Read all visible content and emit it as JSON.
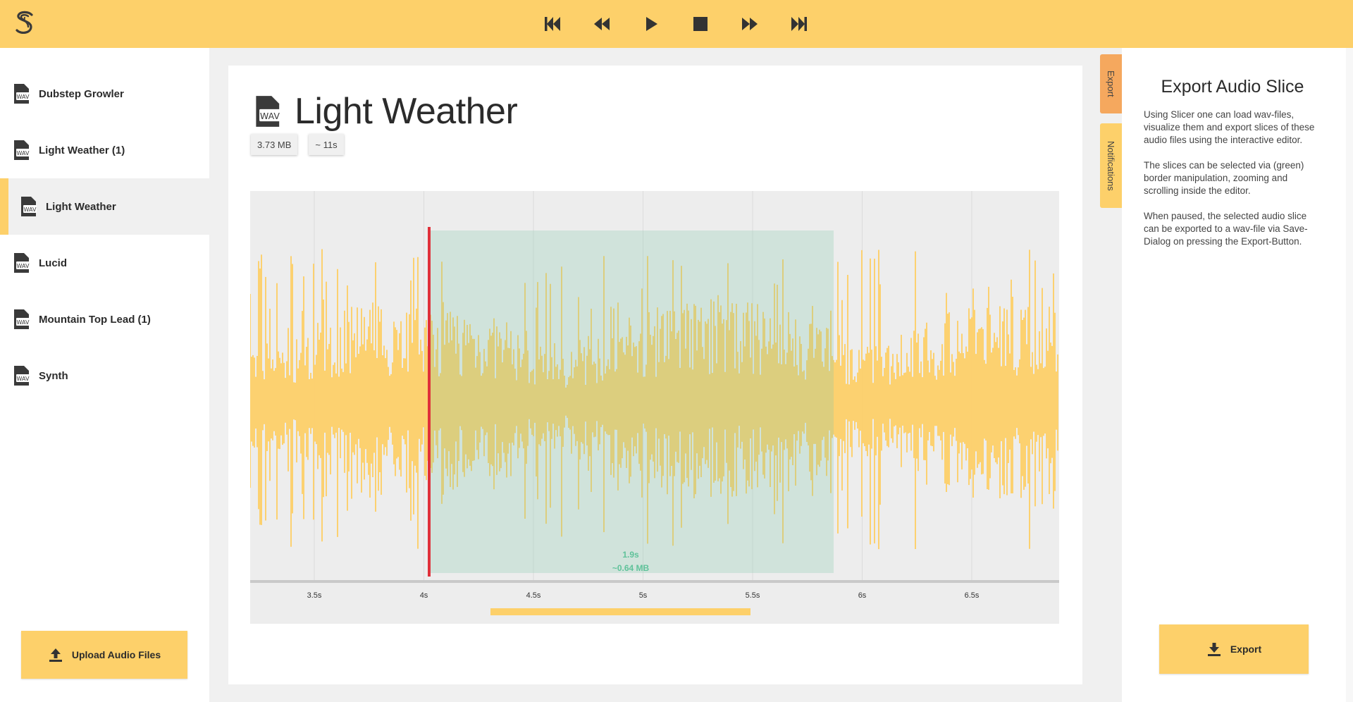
{
  "app": {
    "accent_color": "#fdd06a",
    "export_tab_color": "#f5a85e",
    "selection_color": "#7dc9a8",
    "playhead_color": "#e0303a"
  },
  "topbar": {
    "logo_icon": "slicer-logo-icon",
    "controls": [
      "skip-to-start-icon",
      "rewind-icon",
      "play-icon",
      "stop-icon",
      "fast-forward-icon",
      "skip-to-end-icon"
    ]
  },
  "sidebar": {
    "files": [
      {
        "name": "Dubstep Growler",
        "icon": "wav-file-icon"
      },
      {
        "name": "Light Weather (1)",
        "icon": "wav-file-icon"
      },
      {
        "name": "Light Weather",
        "icon": "wav-file-icon"
      },
      {
        "name": "Lucid",
        "icon": "wav-file-icon"
      },
      {
        "name": "Mountain Top Lead (1)",
        "icon": "wav-file-icon"
      },
      {
        "name": "Synth",
        "icon": "wav-file-icon"
      }
    ],
    "selected_index": 2,
    "upload_label": "Upload Audio Files"
  },
  "main": {
    "title": "Light Weather",
    "size_badge": "3.73 MB",
    "duration_badge": "~ 11s",
    "editor": {
      "ticks": [
        "3.5s",
        "4s",
        "4.5s",
        "5s",
        "5.5s",
        "6s",
        "6.5s"
      ],
      "selection_duration": "1.9s",
      "selection_size": "~0.64 MB"
    }
  },
  "right_tabs": {
    "export": "Export",
    "notifications": "Notifications"
  },
  "right_panel": {
    "title": "Export Audio Slice",
    "paragraphs": [
      "Using Slicer one can load wav-files, visualize them and export slices of these audio files using the interactive editor.",
      "The slices can be selected via (green) border manipulation, zooming and scrolling inside the editor.",
      "When paused, the selected audio slice can be exported to a wav-file via Save-Dialog on pressing the Export-Button."
    ],
    "export_label": "Export"
  }
}
